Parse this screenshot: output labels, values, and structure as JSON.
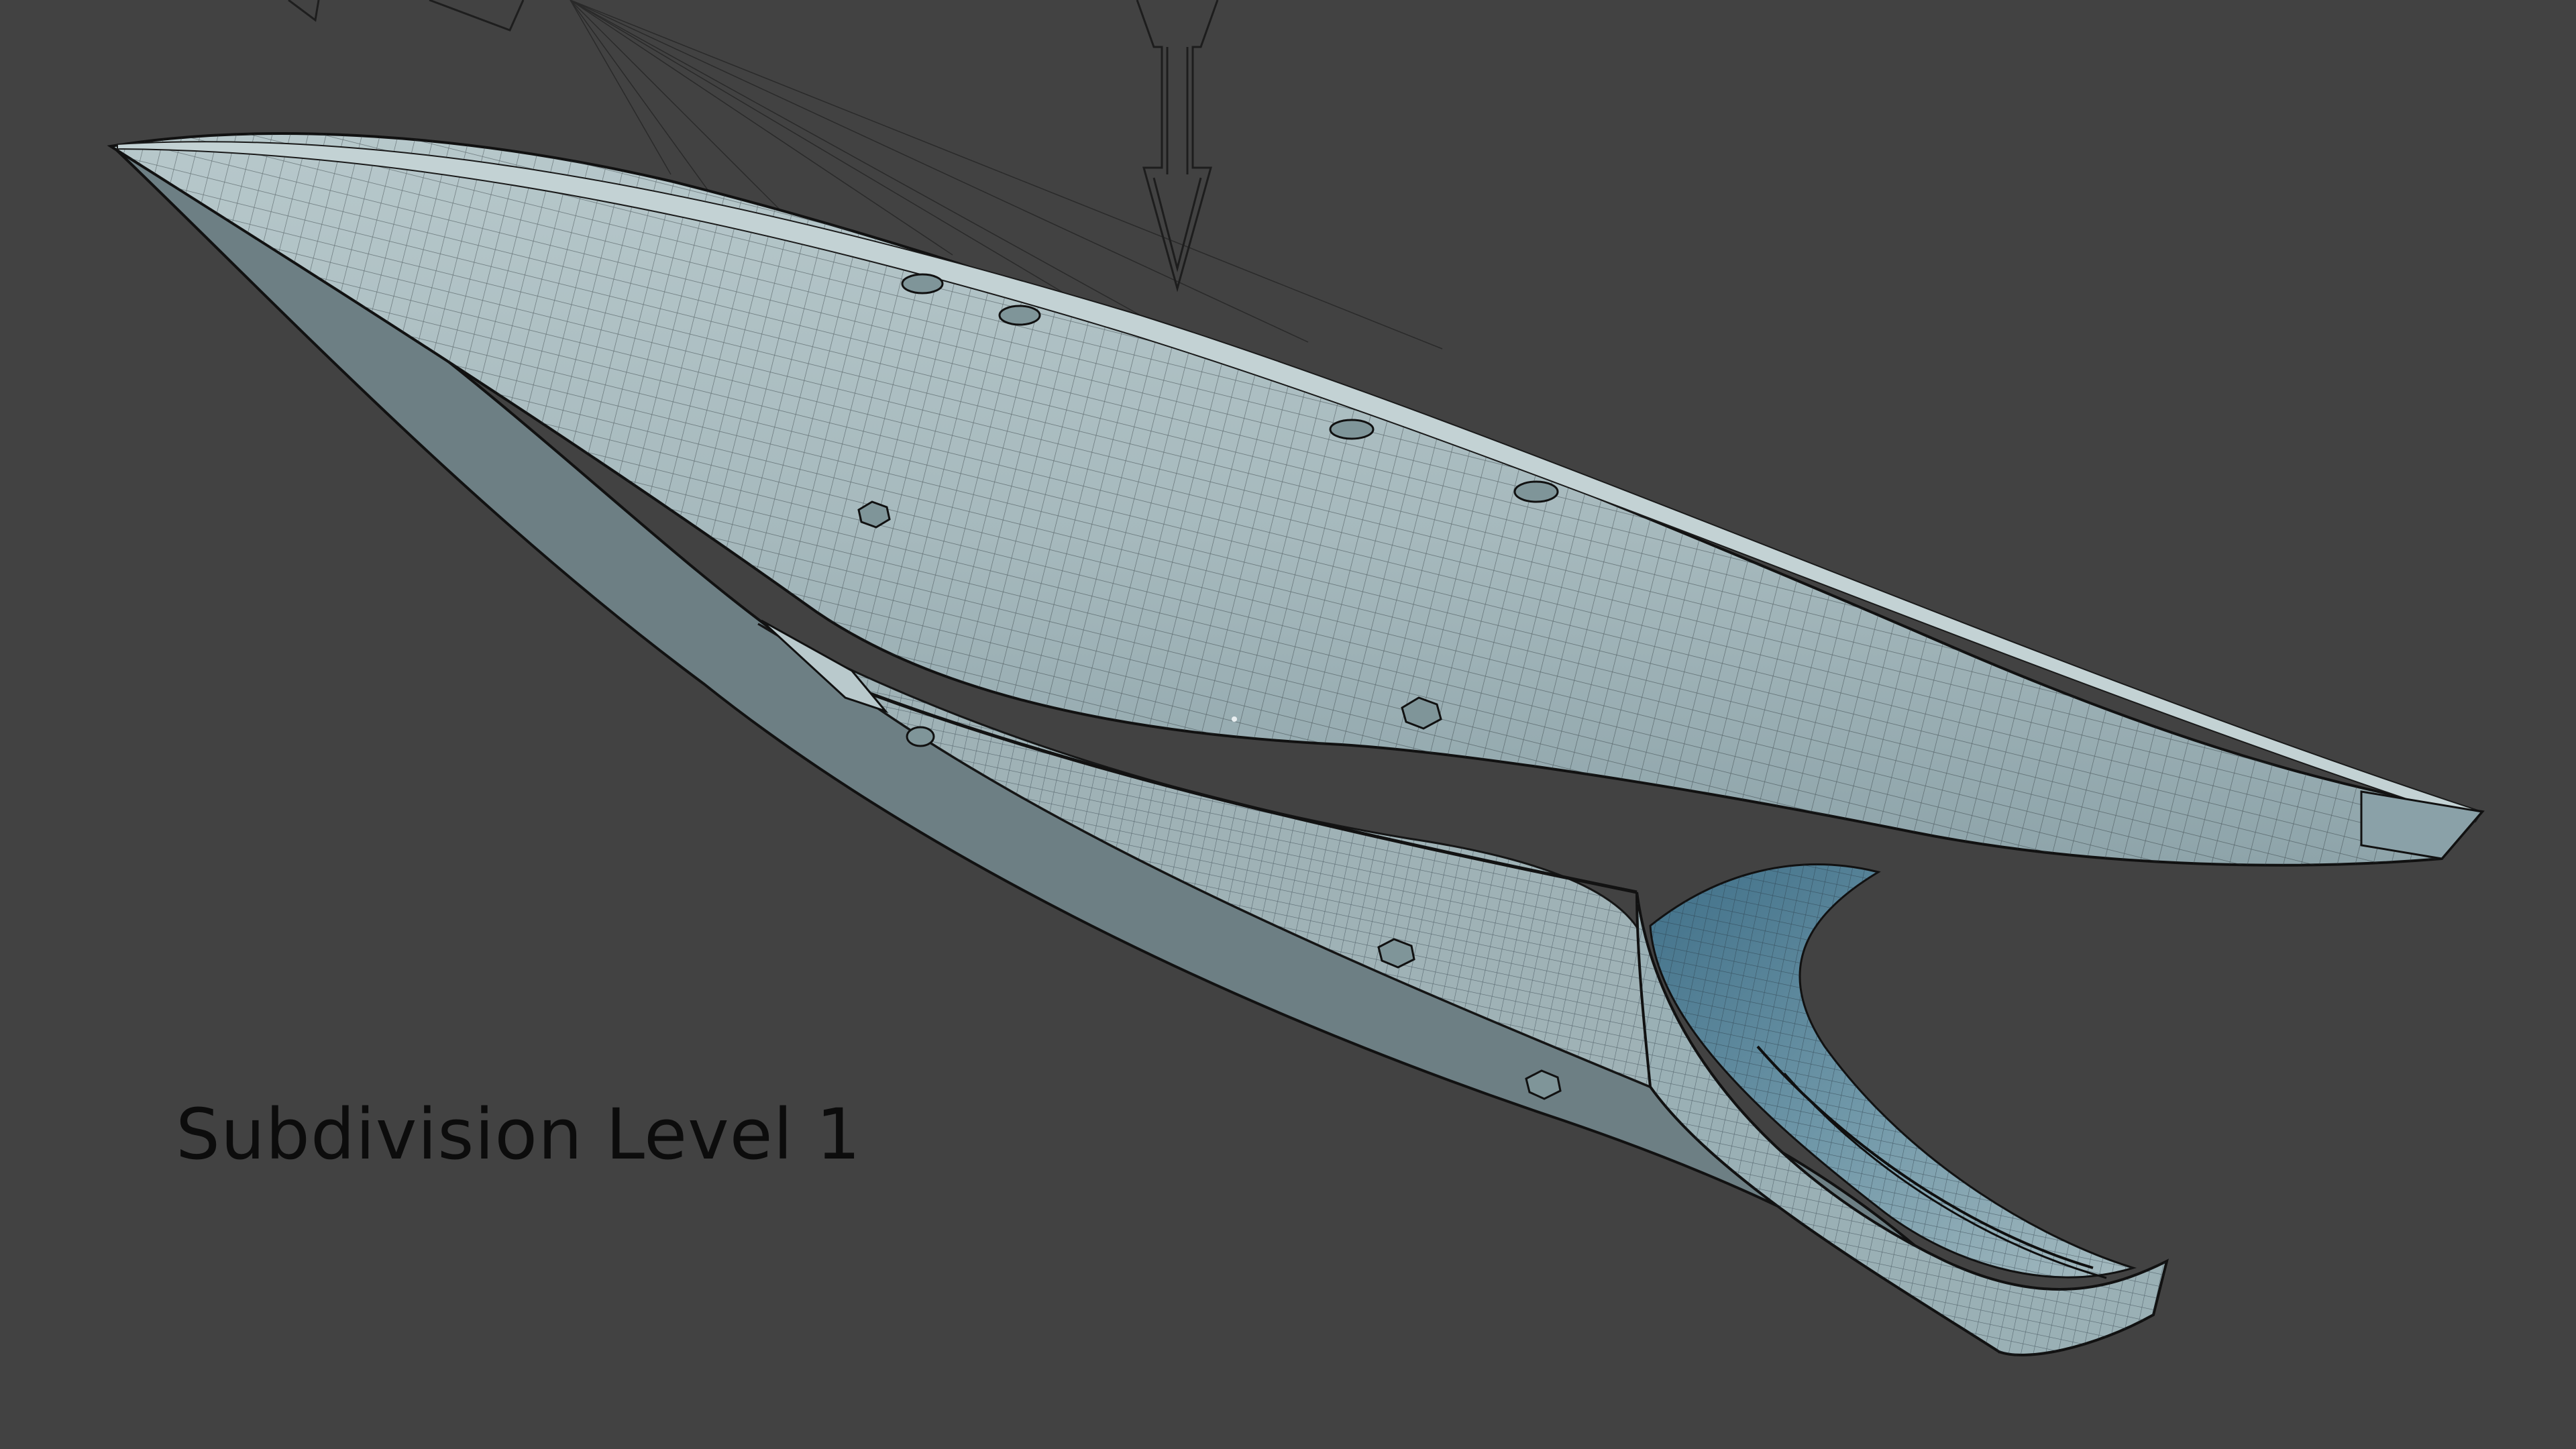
{
  "viewport": {
    "background_color": "#424242",
    "caption": "Subdivision Level 1"
  },
  "model": {
    "surface_color": "#a9bcc0",
    "shadow_color": "#5e8596",
    "wire_color": "#2c3438",
    "outline_color": "#111111"
  },
  "gizmo": {
    "icon": "move-arrow-icon"
  }
}
